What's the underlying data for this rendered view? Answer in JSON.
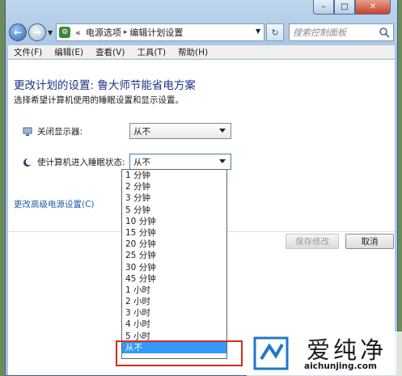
{
  "window": {
    "caption_buttons": {
      "minimize": "–",
      "maximize": "□",
      "close": "✕"
    }
  },
  "address_bar": {
    "breadcrumb_start": "«",
    "segments": [
      "电源选项",
      "编辑计划设置"
    ],
    "separator": "▸",
    "search_placeholder": "搜索控制面板"
  },
  "menu": {
    "items": [
      "文件(F)",
      "编辑(E)",
      "查看(V)",
      "工具(T)",
      "帮助(H)"
    ]
  },
  "content": {
    "title": "更改计划的设置: 鲁大师节能省电方案",
    "subtitle": "选择希望计算机使用的睡眠设置和显示设置。",
    "display_off_label": "关闭显示器:",
    "display_off_value": "从不",
    "sleep_label": "使计算机进入睡眠状态:",
    "sleep_value": "从不",
    "advanced_link": "更改高级电源设置(C)",
    "save_button": "保存修改",
    "cancel_button": "取消"
  },
  "dropdown": {
    "options": [
      "1 分钟",
      "2 分钟",
      "3 分钟",
      "5 分钟",
      "10 分钟",
      "15 分钟",
      "20 分钟",
      "25 分钟",
      "30 分钟",
      "45 分钟",
      "1 小时",
      "2 小时",
      "3 小时",
      "4 小时",
      "5 小时",
      "从不"
    ],
    "selected": "从不"
  },
  "watermark": {
    "brand": "爱纯净",
    "url": "aichunjing.com"
  },
  "colors": {
    "title_blue": "#1e3287",
    "link_blue": "#1f5fa8",
    "selection_blue": "#3399ff",
    "highlight_red": "#d9281e"
  }
}
